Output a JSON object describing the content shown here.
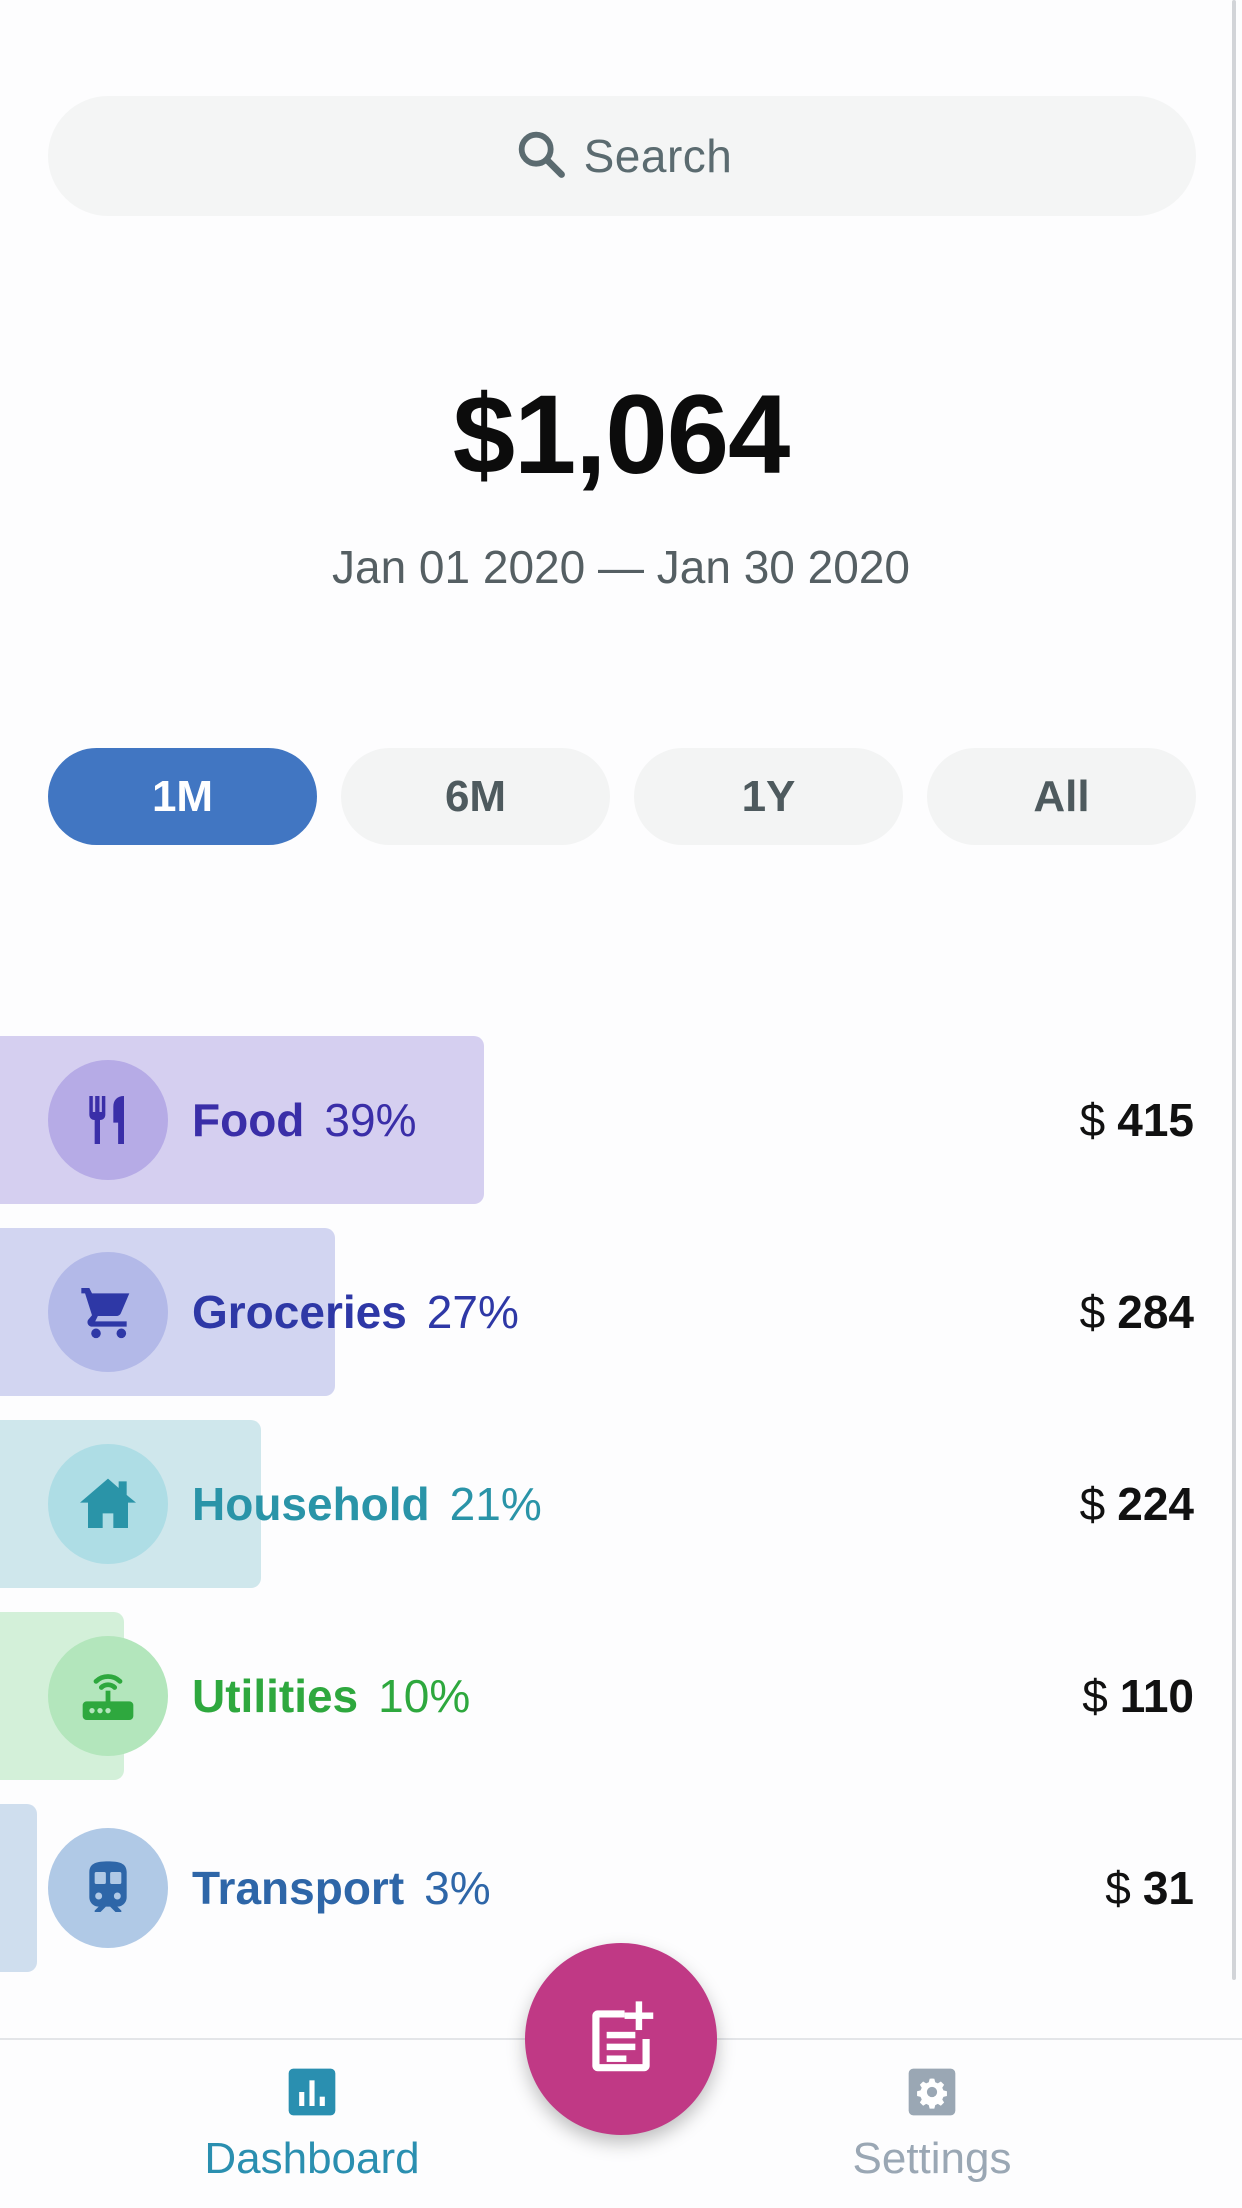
{
  "search": {
    "label": "Search",
    "icon": "search-icon"
  },
  "summary": {
    "total": "$1,064",
    "range": "Jan 01 2020 — Jan 30 2020"
  },
  "periods": [
    {
      "label": "1M",
      "active": true
    },
    {
      "label": "6M",
      "active": false
    },
    {
      "label": "1Y",
      "active": false
    },
    {
      "label": "All",
      "active": false
    }
  ],
  "categories": [
    {
      "name": "Food",
      "percent": "39%",
      "share": 0.39,
      "currency": "$",
      "amount": "415",
      "icon": "food-icon",
      "color": "#3a2ea8",
      "bar_color": "#d5cff0",
      "circle_color": "#b6abe6"
    },
    {
      "name": "Groceries",
      "percent": "27%",
      "share": 0.27,
      "currency": "$",
      "amount": "284",
      "icon": "cart-icon",
      "color": "#2e38a6",
      "bar_color": "#d2d5f1",
      "circle_color": "#b3b9e8"
    },
    {
      "name": "Household",
      "percent": "21%",
      "share": 0.21,
      "currency": "$",
      "amount": "224",
      "icon": "house-icon",
      "color": "#2a94a8",
      "bar_color": "#cfe7ec",
      "circle_color": "#aedde5"
    },
    {
      "name": "Utilities",
      "percent": "10%",
      "share": 0.1,
      "currency": "$",
      "amount": "110",
      "icon": "router-icon",
      "color": "#2ea83e",
      "bar_color": "#d3f0d9",
      "circle_color": "#b3e6bc"
    },
    {
      "name": "Transport",
      "percent": "3%",
      "share": 0.03,
      "currency": "$",
      "amount": "31",
      "icon": "train-icon",
      "color": "#2e66a8",
      "bar_color": "#cfdeee",
      "circle_color": "#b0c9e6"
    }
  ],
  "nav": {
    "dashboard": {
      "label": "Dashboard",
      "icon": "chart-icon",
      "color": "#2a8fb0"
    },
    "settings": {
      "label": "Settings",
      "icon": "gear-icon",
      "color": "#9aa7b4"
    },
    "fab": {
      "icon": "add-note-icon",
      "color": "#c03985"
    }
  }
}
